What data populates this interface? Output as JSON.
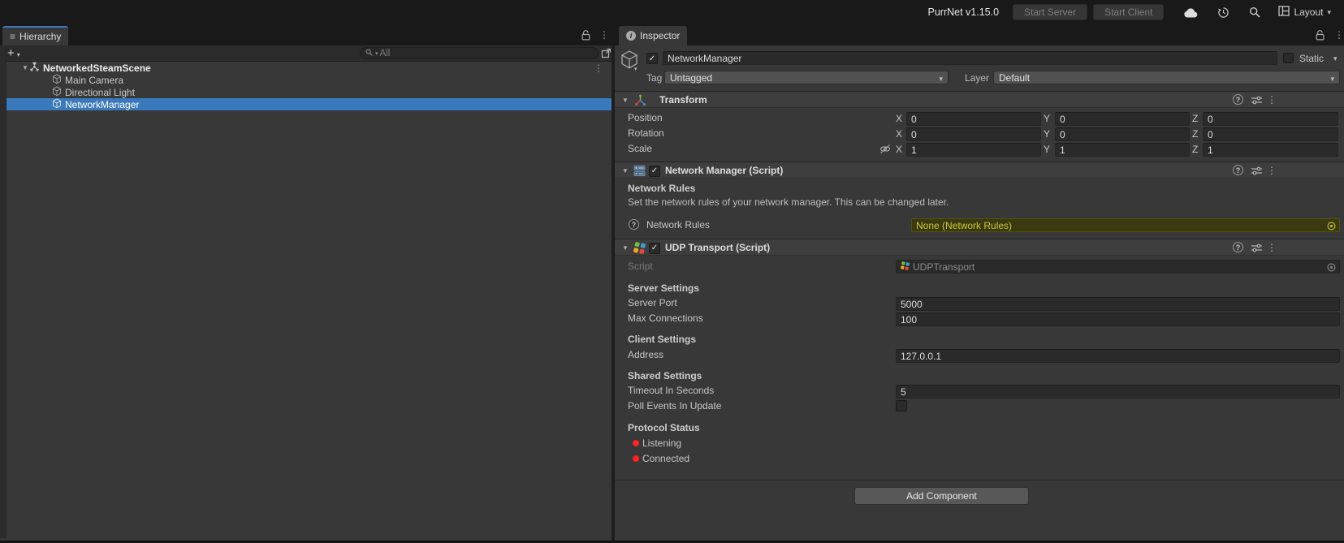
{
  "topbar": {
    "version": "PurrNet v1.15.0",
    "start_server": "Start Server",
    "start_client": "Start Client",
    "layout": "Layout"
  },
  "hierarchy": {
    "tab": "Hierarchy",
    "search_placeholder": "All",
    "scene": "NetworkedSteamScene",
    "items": [
      {
        "label": "Main Camera"
      },
      {
        "label": "Directional Light"
      },
      {
        "label": "NetworkManager"
      }
    ]
  },
  "inspector": {
    "tab": "Inspector",
    "gameobject": {
      "name": "NetworkManager",
      "static_label": "Static",
      "tag_label": "Tag",
      "tag_value": "Untagged",
      "layer_label": "Layer",
      "layer_value": "Default"
    },
    "transform": {
      "title": "Transform",
      "axes": [
        "X",
        "Y",
        "Z"
      ],
      "rows": [
        {
          "label": "Position",
          "x": "0",
          "y": "0",
          "z": "0"
        },
        {
          "label": "Rotation",
          "x": "0",
          "y": "0",
          "z": "0"
        },
        {
          "label": "Scale",
          "x": "1",
          "y": "1",
          "z": "1"
        }
      ]
    },
    "network_manager": {
      "title": "Network Manager (Script)",
      "section": "Network Rules",
      "description": "Set the network rules of your network manager. This can be changed later.",
      "field_label": "Network Rules",
      "field_value": "None (Network Rules)"
    },
    "udp_transport": {
      "title": "UDP Transport (Script)",
      "script_label": "Script",
      "script_value": "UDPTransport",
      "server_settings": "Server Settings",
      "server_port_label": "Server Port",
      "server_port": "5000",
      "max_connections_label": "Max Connections",
      "max_connections": "100",
      "client_settings": "Client Settings",
      "address_label": "Address",
      "address": "127.0.0.1",
      "shared_settings": "Shared Settings",
      "timeout_label": "Timeout In Seconds",
      "timeout": "5",
      "poll_label": "Poll Events In Update",
      "poll_checked": false,
      "protocol_status": "Protocol Status",
      "status_items": [
        {
          "label": "Listening"
        },
        {
          "label": "Connected"
        }
      ]
    },
    "add_component": "Add Component"
  },
  "colors": {
    "selection": "#3A79BB",
    "tab_accent": "#3E78B8",
    "status_dot": "#FF2222",
    "object_field_bg": "#3A390F",
    "object_field_text": "#C9C93C"
  },
  "glyphs": {
    "kebab": "⋮",
    "caret": "▾",
    "foldout": "▼",
    "check": "✓",
    "plus": "+",
    "list": "≡",
    "info": "i",
    "question": "?"
  }
}
